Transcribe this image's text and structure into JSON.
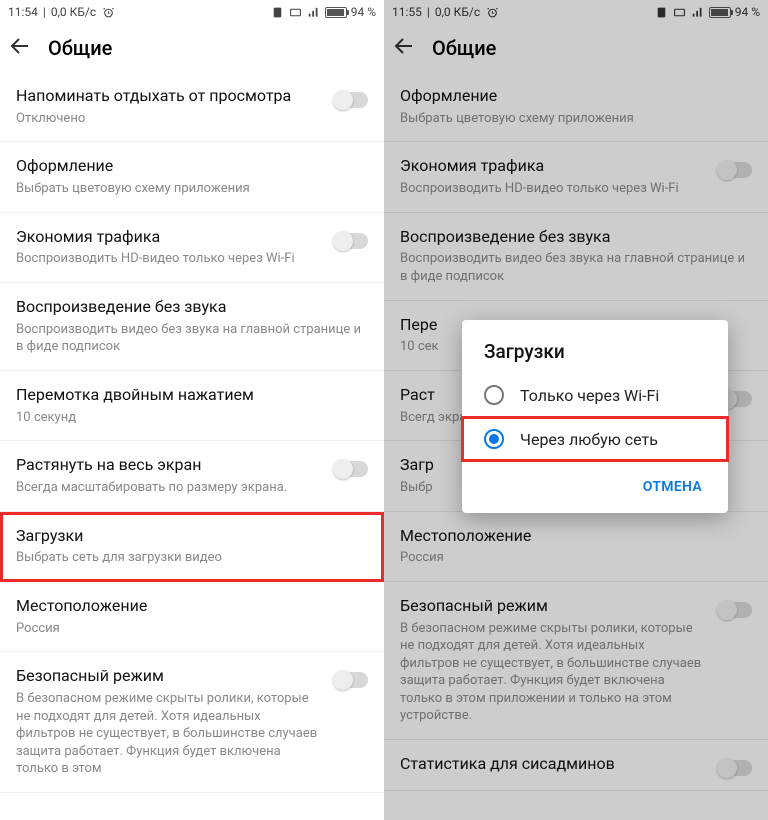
{
  "left": {
    "status": {
      "time": "11:54",
      "net": "0,0 КБ/с",
      "battery": "94"
    },
    "title": "Общие",
    "rows": [
      {
        "title": "Напоминать отдыхать от просмотра",
        "sub": "Отключено",
        "switch": true
      },
      {
        "title": "Оформление",
        "sub": "Выбрать цветовую схему приложения",
        "switch": false
      },
      {
        "title": "Экономия трафика",
        "sub": "Воспроизводить HD-видео только через Wi-Fi",
        "switch": true
      },
      {
        "title": "Воспроизведение без звука",
        "sub": "Воспроизводить видео без звука на главной странице и в фиде подписок",
        "switch": false
      },
      {
        "title": "Перемотка двойным нажатием",
        "sub": "10 секунд",
        "switch": false
      },
      {
        "title": "Растянуть на весь экран",
        "sub": "Всегда масштабировать по размеру экрана.",
        "switch": true
      },
      {
        "title": "Загрузки",
        "sub": "Выбрать сеть для загрузки видео",
        "switch": false,
        "hl": true
      },
      {
        "title": "Местоположение",
        "sub": "Россия",
        "switch": false
      },
      {
        "title": "Безопасный режим",
        "sub": "В безопасном режиме скрыты ролики, которые не подходят для детей. Хотя идеальных фильтров не существует, в большинстве случаев защита работает. Функция будет включена только в этом",
        "switch": true
      }
    ]
  },
  "right": {
    "status": {
      "time": "11:55",
      "net": "0,0 КБ/с",
      "battery": "94"
    },
    "title": "Общие",
    "rows": [
      {
        "title": "Оформление",
        "sub": "Выбрать цветовую схему приложения",
        "switch": false
      },
      {
        "title": "Экономия трафика",
        "sub": "Воспроизводить HD-видео только через Wi-Fi",
        "switch": true
      },
      {
        "title": "Воспроизведение без звука",
        "sub": "Воспроизводить видео без звука на главной странице и в фиде подписок",
        "switch": false
      },
      {
        "title": "Пере",
        "sub": "10 сек",
        "switch": false
      },
      {
        "title": "Раст",
        "sub": "Всегд экран",
        "switch": true
      },
      {
        "title": "Загр",
        "sub": "Выбр",
        "switch": false
      },
      {
        "title": "Местоположение",
        "sub": "Россия",
        "switch": false
      },
      {
        "title": "Безопасный режим",
        "sub": "В безопасном режиме скрыты ролики, которые не подходят для детей. Хотя идеальных фильтров не существует, в большинстве случаев защита работает. Функция будет включена только в этом приложении и только на этом устройстве.",
        "switch": true
      },
      {
        "title": "Статистика для сисадминов",
        "sub": "",
        "switch": true
      }
    ],
    "dialog": {
      "title": "Загрузки",
      "options": [
        {
          "label": "Только через Wi-Fi",
          "checked": false,
          "hl": false
        },
        {
          "label": "Через любую сеть",
          "checked": true,
          "hl": true
        }
      ],
      "cancel": "ОТМЕНА"
    }
  }
}
